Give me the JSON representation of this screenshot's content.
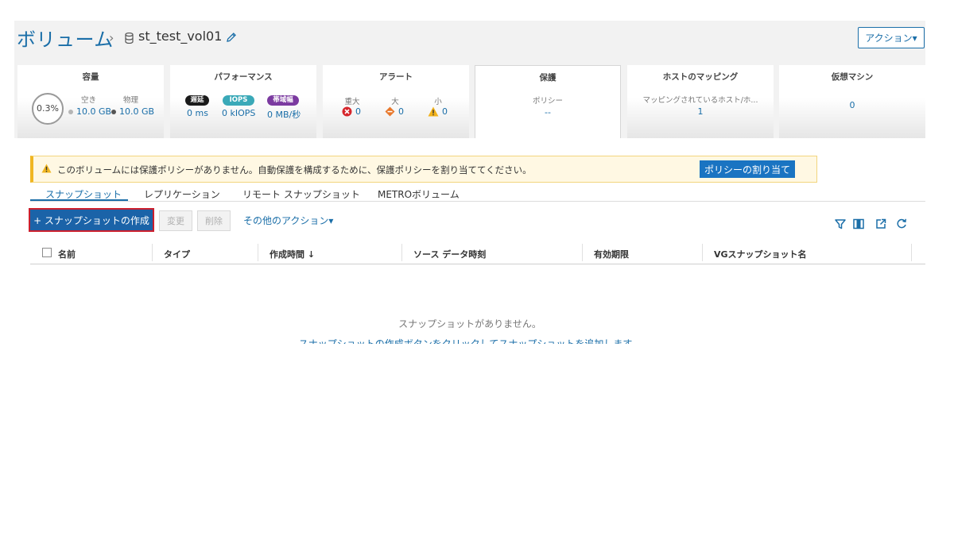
{
  "header": {
    "breadcrumb_root": "ボリューム",
    "breadcrumb_current": "st_test_vol01",
    "actions_label": "アクション▾"
  },
  "cards": {
    "capacity": {
      "title": "容量",
      "percent": "0.3%",
      "free_label": "空き",
      "free_value": "10.0 GB",
      "physical_label": "物理",
      "physical_value": "10.0 GB"
    },
    "performance": {
      "title": "パフォーマンス",
      "latency_label": "遅延",
      "latency_value": "0 ms",
      "iops_label": "IOPS",
      "iops_value": "0 kIOPS",
      "bandwidth_label": "帯域幅",
      "bandwidth_value": "0 MB/秒"
    },
    "alerts": {
      "title": "アラート",
      "critical_label": "重大",
      "critical_value": "0",
      "major_label": "大",
      "major_value": "0",
      "minor_label": "小",
      "minor_value": "0"
    },
    "protection": {
      "title": "保護",
      "policy_label": "ポリシー",
      "policy_value": "--"
    },
    "host_mapping": {
      "title": "ホストのマッピング",
      "label": "マッピングされているホスト/ホ...",
      "value": "1"
    },
    "vm": {
      "title": "仮想マシン",
      "value": "0"
    }
  },
  "banner": {
    "text": "このボリュームには保護ポリシーがありません。自動保護を構成するために、保護ポリシーを割り当ててください。",
    "button": "ポリシーの割り当て"
  },
  "tabs": [
    {
      "label": "スナップショット"
    },
    {
      "label": "レプリケーション"
    },
    {
      "label": "リモート スナップショット"
    },
    {
      "label": "METROボリューム"
    }
  ],
  "toolbar": {
    "create": "+ スナップショットの作成",
    "modify": "変更",
    "delete": "削除",
    "more": "その他のアクション▾"
  },
  "table": {
    "columns": [
      "名前",
      "タイプ",
      "作成時間 ↓",
      "ソース データ時刻",
      "有効期限",
      "VGスナップショット名"
    ]
  },
  "empty": {
    "message": "スナップショットがありません。",
    "hint": "スナップショットの作成ボタンをクリックしてスナップショットを追加します。"
  },
  "colors": {
    "accent": "#1a6ea8",
    "primary_button": "#1a74c2",
    "highlight_border": "#cc1f2d",
    "warning": "#f0b622",
    "latency_pill": "#1a1a1a",
    "iops_pill": "#3aa9b8",
    "bandwidth_pill": "#7b3aa0",
    "critical": "#d6262c",
    "major": "#e8782c",
    "minor": "#f2b21b"
  }
}
